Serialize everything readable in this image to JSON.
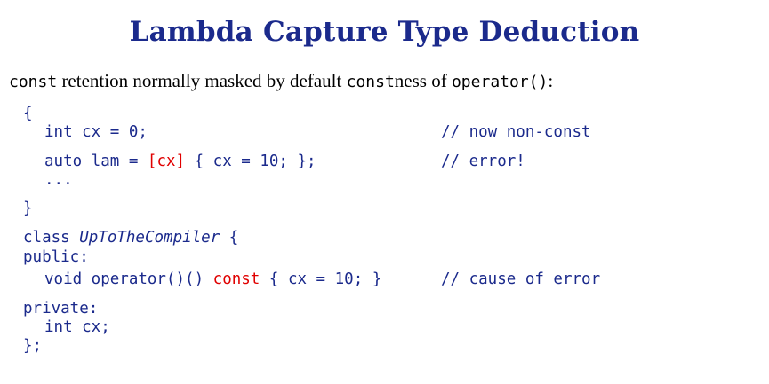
{
  "slide": {
    "title": "Lambda Capture Type Deduction",
    "subtitle": {
      "code1": "const",
      "text1": " retention normally masked by default ",
      "code2": "const",
      "text2": "ness of ",
      "code3": "operator()",
      "text3": ":"
    }
  },
  "code": {
    "l1": "{",
    "l2": "int cx = 0;",
    "l2_comment": "// now non-const",
    "l3_a": "auto lam = ",
    "l3_red": "[cx]",
    "l3_b": " { cx = 10; };",
    "l3_comment": "// error!",
    "l4": "...",
    "l5": "}",
    "l6_a": "class ",
    "l6_name": "UpToTheCompiler",
    "l6_b": " {",
    "l7": "public:",
    "l8_a": "void operator()() ",
    "l8_red": "const",
    "l8_b": " { cx = 10; }",
    "l8_comment": "// cause of error",
    "l9": "private:",
    "l10": "int cx;",
    "l11": "};"
  },
  "colors": {
    "title": "#1b2a8c",
    "code": "#1b2a8c",
    "highlight": "#e00000",
    "text": "#000000"
  }
}
